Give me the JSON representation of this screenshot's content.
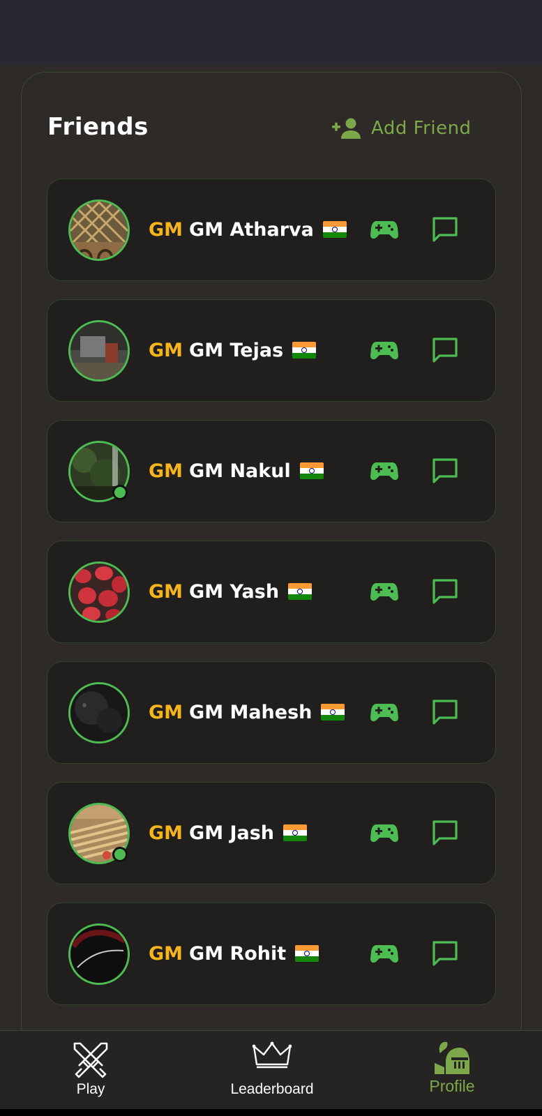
{
  "header": {
    "title": "Friends",
    "add_friend_label": "Add Friend"
  },
  "friends": [
    {
      "badge": "GM",
      "name": "GM Atharva",
      "online": false
    },
    {
      "badge": "GM",
      "name": "GM Tejas",
      "online": false
    },
    {
      "badge": "GM",
      "name": "GM Nakul",
      "online": true
    },
    {
      "badge": "GM",
      "name": "GM Yash",
      "online": false
    },
    {
      "badge": "GM",
      "name": "GM Mahesh",
      "online": false
    },
    {
      "badge": "GM",
      "name": "GM Jash",
      "online": true
    },
    {
      "badge": "GM",
      "name": "GM Rohit",
      "online": false
    }
  ],
  "nav": {
    "play": "Play",
    "leaderboard": "Leaderboard",
    "profile": "Profile",
    "active": "profile"
  },
  "colors": {
    "accent_green": "#4dbd53",
    "olive_green": "#7da84a",
    "badge_gold": "#f5b51b",
    "card_bg": "#211f1d",
    "page_bg": "#2d2a27"
  },
  "icons": {
    "add_friend": "person-add-icon",
    "play": "gamepad-icon",
    "chat": "chat-bubble-icon",
    "nav_play": "crossed-swords-icon",
    "nav_leaderboard": "crown-icon",
    "nav_profile": "knight-helmet-icon"
  }
}
